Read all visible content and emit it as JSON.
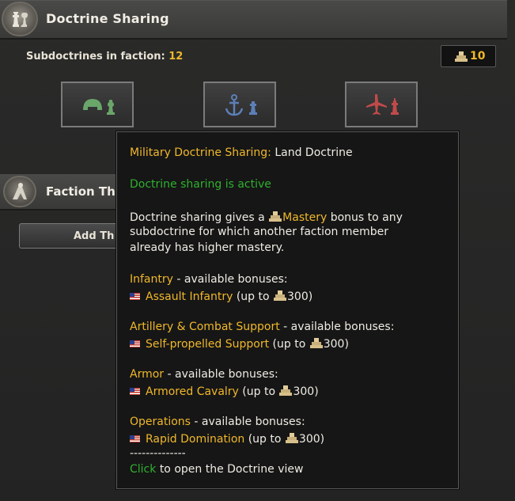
{
  "header": {
    "title": "Doctrine Sharing",
    "icon": "chess-pieces-icon"
  },
  "faction": {
    "subdoctrines_label": "Subdoctrines in faction:",
    "subdoctrines_count": "12",
    "mastery_value": "10"
  },
  "doctrine_buttons": [
    {
      "name": "land-doctrine-button",
      "icon": "helmet-icon"
    },
    {
      "name": "naval-doctrine-button",
      "icon": "anchor-icon"
    },
    {
      "name": "air-doctrine-button",
      "icon": "plane-icon"
    }
  ],
  "section2": {
    "title": "Faction Th",
    "add_button": "Add Th"
  },
  "tooltip": {
    "title_label": "Military Doctrine Sharing:",
    "title_value": "Land Doctrine",
    "status": "Doctrine sharing is active",
    "desc_line1_a": "Doctrine sharing gives a",
    "desc_mastery": "Mastery",
    "desc_line1_b": "bonus to any",
    "desc_line2": "subdoctrine for which another faction member",
    "desc_line3": "already has higher mastery.",
    "groups": [
      {
        "name": "Infantry",
        "suffix": "- available bonuses:",
        "item": "Assault Infantry",
        "up_to": "(up to",
        "value": "300)"
      },
      {
        "name": "Artillery & Combat Support",
        "suffix": "- available bonuses:",
        "item": "Self-propelled Support",
        "up_to": "(up to",
        "value": "300)"
      },
      {
        "name": "Armor",
        "suffix": "- available bonuses:",
        "item": "Armored Cavalry",
        "up_to": "(up to",
        "value": "300)"
      },
      {
        "name": "Operations",
        "suffix": "- available bonuses:",
        "item": "Rapid Domination",
        "up_to": "(up to",
        "value": "300)"
      }
    ],
    "separator": "--------------",
    "click_word": "Click",
    "click_rest": "to open the Doctrine view"
  },
  "colors": {
    "accent": "#f0b82a",
    "active": "#2fb02f",
    "land": "#6aa66a",
    "naval": "#5d7fb8",
    "air": "#c04a4a"
  }
}
